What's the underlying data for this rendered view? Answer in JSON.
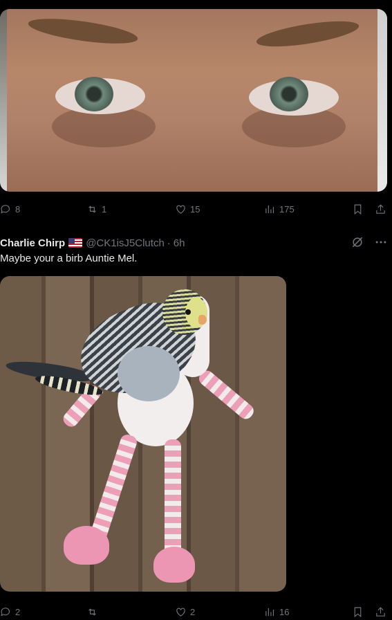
{
  "tweet1": {
    "stats": {
      "replies": "8",
      "reposts": "1",
      "likes": "15",
      "views": "175"
    }
  },
  "tweet2": {
    "author_name": "Charlie Chirp",
    "flag": "us-flag-emoji",
    "handle": "@CK1isJ5Clutch",
    "separator": "·",
    "time": "6h",
    "text": "Maybe your a birb Auntie Mel.",
    "stats": {
      "replies": "2",
      "reposts": "",
      "likes": "2",
      "views": "16"
    }
  },
  "icons": {
    "reply": "speech-bubble-icon",
    "repost": "repost-arrows-icon",
    "like": "heart-icon",
    "views": "bar-chart-icon",
    "bookmark": "bookmark-icon",
    "share": "share-upload-icon",
    "grok": "grok-slash-circle-icon",
    "more": "more-dots-icon"
  },
  "colors": {
    "background": "#000000",
    "text": "#e7e9ea",
    "muted": "#71767b"
  }
}
